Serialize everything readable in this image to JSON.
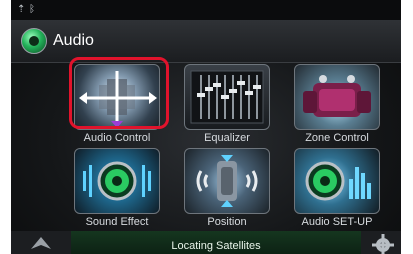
{
  "app": {
    "title": "Audio"
  },
  "status_bar": {
    "left_icons": [
      "usb-icon",
      "bluetooth-icon"
    ]
  },
  "tiles": [
    {
      "label": "Audio Control",
      "icon": "audio-control-icon",
      "selected": true
    },
    {
      "label": "Equalizer",
      "icon": "equalizer-icon"
    },
    {
      "label": "Zone Control",
      "icon": "zone-control-icon"
    },
    {
      "label": "Sound Effect",
      "icon": "sound-effect-icon"
    },
    {
      "label": "Position",
      "icon": "position-icon"
    },
    {
      "label": "Audio SET-UP",
      "icon": "audio-setup-icon"
    }
  ],
  "footer": {
    "status_text": "Locating Satellites"
  },
  "colors": {
    "accent": "#e1132c",
    "brand_green": "#23b25a",
    "status_bar_bg": "#0d2214"
  }
}
